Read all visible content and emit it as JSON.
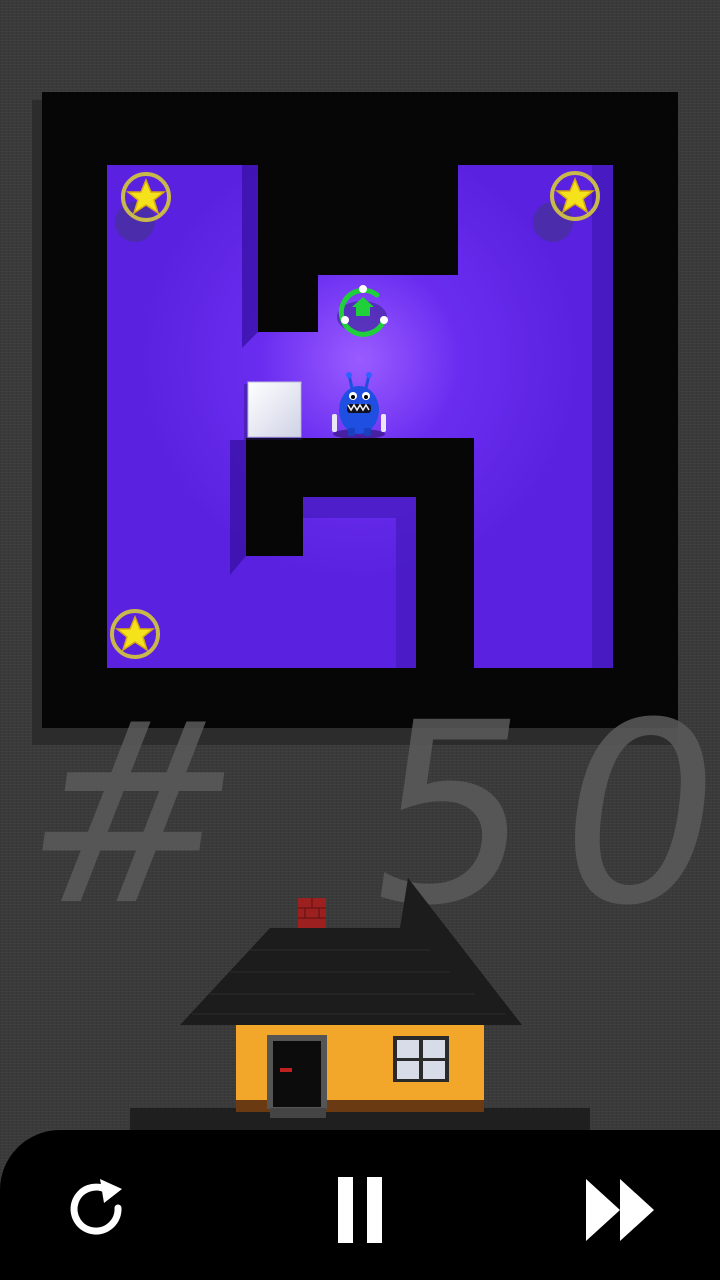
{
  "level": {
    "label": "# 50"
  },
  "stars": [
    {
      "name": "star-top-left",
      "collected": false
    },
    {
      "name": "star-top-right",
      "collected": false
    },
    {
      "name": "star-bottom-left",
      "collected": false
    }
  ],
  "controls": {
    "restart_icon": "restart-icon",
    "pause_icon": "pause-icon",
    "skip_icon": "fast-forward-icon"
  },
  "colors": {
    "floor": "#6a2df0",
    "wall": "#060606",
    "star": "#f4e21a",
    "star_ring": "#c9b84a",
    "goal": "#1fd03a",
    "character": "#1f4fe0",
    "house_wall": "#f2a62a",
    "roof": "#1c1c1c",
    "chimney": "#9c2020",
    "background": "#3a3a3a",
    "control_bar": "#000000"
  }
}
